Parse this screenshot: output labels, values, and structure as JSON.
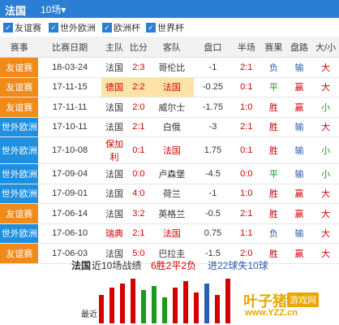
{
  "header": {
    "team": "法国",
    "range_select": "10场▾"
  },
  "filters": [
    {
      "label": "友谊赛",
      "checked": true
    },
    {
      "label": "世外欧洲",
      "checked": true
    },
    {
      "label": "欧洲杯",
      "checked": true
    },
    {
      "label": "世界杯",
      "checked": true
    }
  ],
  "columns": [
    "赛事",
    "比赛日期",
    "主队",
    "比分",
    "客队",
    "盘口",
    "半场",
    "赛果",
    "盘路",
    "大/小"
  ],
  "rows": [
    {
      "event": "友谊赛",
      "type": "friendly",
      "date": "18-03-24",
      "home": "法国",
      "score": "2:3",
      "away": "哥伦比",
      "line": "-1",
      "half": "2:1",
      "result": "负",
      "cover": "输",
      "ou": "大"
    },
    {
      "event": "友谊赛",
      "type": "friendly",
      "date": "17-11-15",
      "home": "德国",
      "score": "2:2",
      "away": "法国",
      "line": "-0.25",
      "half": "0:1",
      "result": "平",
      "cover": "赢",
      "ou": "大"
    },
    {
      "event": "友谊赛",
      "type": "friendly",
      "date": "17-11-11",
      "home": "法国",
      "score": "2:0",
      "away": "威尔士",
      "line": "-1.75",
      "half": "1:0",
      "result": "胜",
      "cover": "赢",
      "ou": "小"
    },
    {
      "event": "世外欧洲",
      "type": "wcq",
      "date": "17-10-11",
      "home": "法国",
      "score": "2:1",
      "away": "白俄",
      "line": "-3",
      "half": "2:1",
      "result": "胜",
      "cover": "输",
      "ou": "大"
    },
    {
      "event": "世外欧洲",
      "type": "wcq",
      "date": "17-10-08",
      "home": "保加利",
      "score": "0:1",
      "away": "法国",
      "line": "1.75",
      "half": "0:1",
      "result": "胜",
      "cover": "输",
      "ou": "小"
    },
    {
      "event": "世外欧洲",
      "type": "wcq",
      "date": "17-09-04",
      "home": "法国",
      "score": "0:0",
      "away": "卢森堡",
      "line": "-4.5",
      "half": "0:0",
      "result": "平",
      "cover": "输",
      "ou": "小"
    },
    {
      "event": "世外欧洲",
      "type": "wcq",
      "date": "17-09-01",
      "home": "法国",
      "score": "4:0",
      "away": "荷兰",
      "line": "-1",
      "half": "1:0",
      "result": "胜",
      "cover": "赢",
      "ou": "大"
    },
    {
      "event": "友谊赛",
      "type": "friendly",
      "date": "17-06-14",
      "home": "法国",
      "score": "3:2",
      "away": "英格兰",
      "line": "-0.5",
      "half": "2:1",
      "result": "胜",
      "cover": "赢",
      "ou": "大"
    },
    {
      "event": "世外欧洲",
      "type": "wcq",
      "date": "17-06-10",
      "home": "瑞典",
      "score": "2:1",
      "away": "法国",
      "line": "0.75",
      "half": "1:1",
      "result": "负",
      "cover": "输",
      "ou": "大"
    },
    {
      "event": "友谊赛",
      "type": "friendly",
      "date": "17-06-03",
      "home": "法国",
      "score": "5:0",
      "away": "巴拉圭",
      "line": "-1.5",
      "half": "2:0",
      "result": "胜",
      "cover": "赢",
      "ou": "大"
    }
  ],
  "summary": {
    "team": "法国",
    "recent": "近10场战绩",
    "record": "6胜2平2负",
    "goals": "进22球失10球"
  },
  "chart_label": "最近",
  "bars": [
    {
      "level": 0.6,
      "color": "#d40000"
    },
    {
      "level": 0.75,
      "color": "#d40000"
    },
    {
      "level": 0.85,
      "color": "#d40000"
    },
    {
      "level": 0.95,
      "color": "#d40000"
    },
    {
      "level": 0.7,
      "color": "#1a9a1a"
    },
    {
      "level": 0.8,
      "color": "#1a9a1a"
    },
    {
      "level": 0.55,
      "color": "#1a9a1a"
    },
    {
      "level": 0.75,
      "color": "#d40000"
    },
    {
      "level": 0.9,
      "color": "#d40000"
    },
    {
      "level": 0.65,
      "color": "#d40000"
    },
    {
      "level": 0.85,
      "color": "#2a5fb0"
    },
    {
      "level": 0.6,
      "color": "#d40000"
    },
    {
      "level": 0.95,
      "color": "#d40000"
    }
  ],
  "logo": {
    "name": "叶子猪",
    "tag": "游戏网",
    "url": "www.YZZ.cn"
  }
}
